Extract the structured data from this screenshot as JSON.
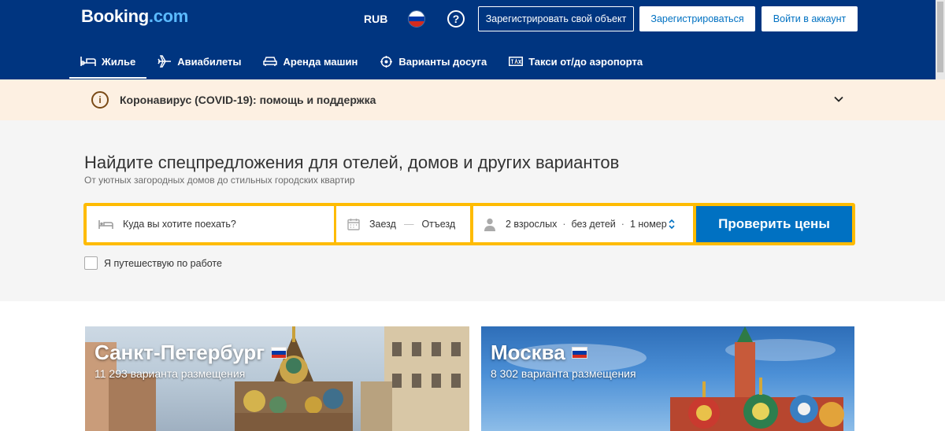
{
  "header": {
    "logo_main": "Booking",
    "logo_dot": ".com",
    "currency": "RUB",
    "help_symbol": "?",
    "list_property": "Зарегистрировать свой объект",
    "register": "Зарегистрироваться",
    "sign_in": "Войти в аккаунт"
  },
  "nav": {
    "items": [
      {
        "label": "Жилье",
        "icon": "bed-icon"
      },
      {
        "label": "Авиабилеты",
        "icon": "plane-icon"
      },
      {
        "label": "Аренда машин",
        "icon": "car-icon"
      },
      {
        "label": "Варианты досуга",
        "icon": "attractions-icon"
      },
      {
        "label": "Такси от/до аэропорта",
        "icon": "taxi-icon"
      }
    ]
  },
  "covid": {
    "icon_symbol": "i",
    "text": "Коронавирус (COVID-19): помощь и поддержка"
  },
  "search": {
    "title": "Найдите спецпредложения для отелей, домов и других вариантов",
    "subtitle": "От уютных загородных домов до стильных городских квартир",
    "destination_placeholder": "Куда вы хотите поехать?",
    "checkin": "Заезд",
    "checkout": "Отъезд",
    "adults": "2 взрослых",
    "children": "без детей",
    "rooms": "1 номер",
    "submit": "Проверить цены",
    "work_trip": "Я путешествую по работе"
  },
  "destinations": [
    {
      "name": "Санкт-Петербург",
      "count": "11 293 варианта размещения"
    },
    {
      "name": "Москва",
      "count": "8 302 варианта размещения"
    }
  ],
  "colors": {
    "brand": "#003580",
    "accent": "#febb02",
    "button": "#0071c2"
  }
}
